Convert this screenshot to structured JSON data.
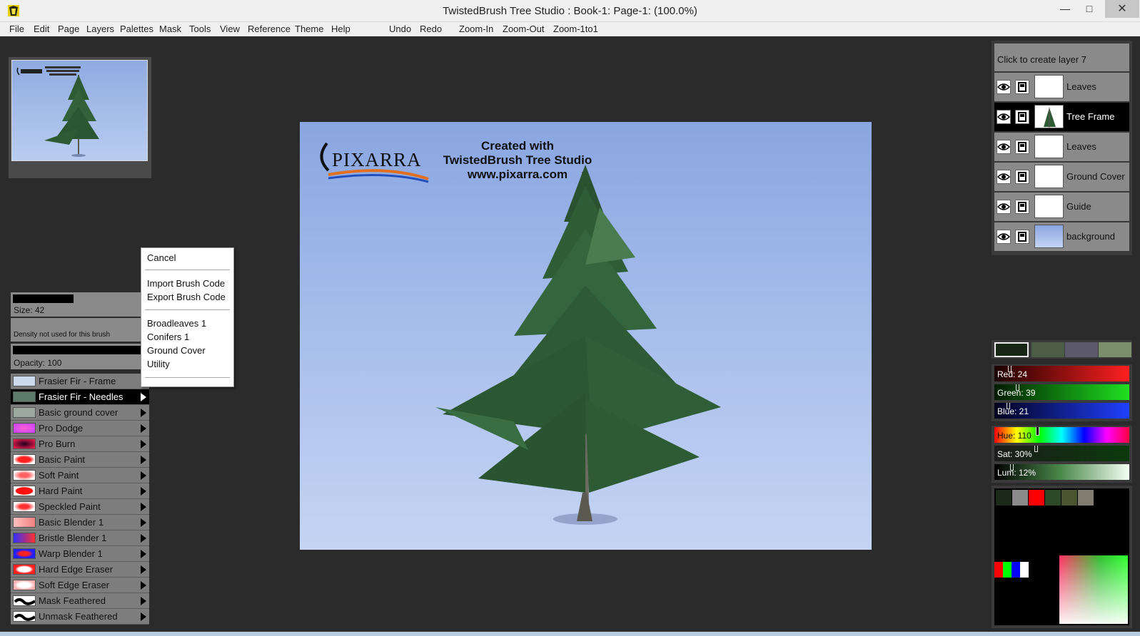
{
  "window": {
    "title": "TwistedBrush Tree Studio : Book-1: Page-1:  (100.0%)",
    "minimize": "—",
    "maximize": "□",
    "close": "✕"
  },
  "menu": [
    "File",
    "Edit",
    "Page",
    "Layers",
    "Palettes",
    "Mask",
    "Tools",
    "View",
    "Reference",
    "Theme",
    "Help"
  ],
  "toolbar": {
    "undo": "Undo",
    "redo": "Redo",
    "zoom_in": "Zoom-In",
    "zoom_out": "Zoom-Out",
    "zoom_1to1": "Zoom-1to1"
  },
  "brush_params": {
    "size": "Size: 42",
    "density": "Density not used for this brush",
    "opacity": "Opacity: 100"
  },
  "brushes": [
    {
      "label": "Frasier Fir - Frame",
      "selected": false
    },
    {
      "label": "Frasier Fir - Needles",
      "selected": true
    },
    {
      "label": "Basic ground cover",
      "selected": false
    },
    {
      "label": "Pro Dodge",
      "selected": false
    },
    {
      "label": "Pro Burn",
      "selected": false
    },
    {
      "label": "Basic Paint",
      "selected": false
    },
    {
      "label": "Soft Paint",
      "selected": false
    },
    {
      "label": "Hard Paint",
      "selected": false
    },
    {
      "label": "Speckled Paint",
      "selected": false
    },
    {
      "label": "Basic Blender 1",
      "selected": false
    },
    {
      "label": "Bristle Blender 1",
      "selected": false
    },
    {
      "label": "Warp Blender 1",
      "selected": false
    },
    {
      "label": "Hard Edge Eraser",
      "selected": false
    },
    {
      "label": "Soft Edge Eraser",
      "selected": false
    },
    {
      "label": "Mask Feathered",
      "selected": false
    },
    {
      "label": "Unmask Feathered",
      "selected": false
    }
  ],
  "context_menu": {
    "cancel": "Cancel",
    "import": "Import Brush Code",
    "export": "Export Brush Code",
    "categories": [
      "Broadleaves 1",
      "Conifers 1",
      "Ground Cover",
      "Utility"
    ]
  },
  "canvas": {
    "logo": "PIXARRA",
    "created_lines": [
      "Created with",
      "TwistedBrush Tree Studio",
      "www.pixarra.com"
    ]
  },
  "layers": {
    "create": "Click to create layer 7",
    "items": [
      {
        "label": "Leaves",
        "selected": false
      },
      {
        "label": "Tree Frame",
        "selected": true
      },
      {
        "label": "Leaves",
        "selected": false
      },
      {
        "label": "Ground Cover",
        "selected": false
      },
      {
        "label": "Guide",
        "selected": false
      },
      {
        "label": "background",
        "selected": false
      }
    ]
  },
  "color": {
    "current": "#182715",
    "swatches": [
      "#4c5c45",
      "#5c5a6a",
      "#7c8f6c"
    ],
    "red": "Red: 24",
    "green": "Green: 39",
    "blue": "Blue: 21",
    "hue": "Hue: 110",
    "sat": "Sat: 30%",
    "lum": "Lum: 12%",
    "mixer_swatches": [
      "#1c2a1a",
      "#8a8a8a",
      "#ff0000",
      "#2d4a28",
      "#4a5530",
      "#807c70"
    ]
  }
}
